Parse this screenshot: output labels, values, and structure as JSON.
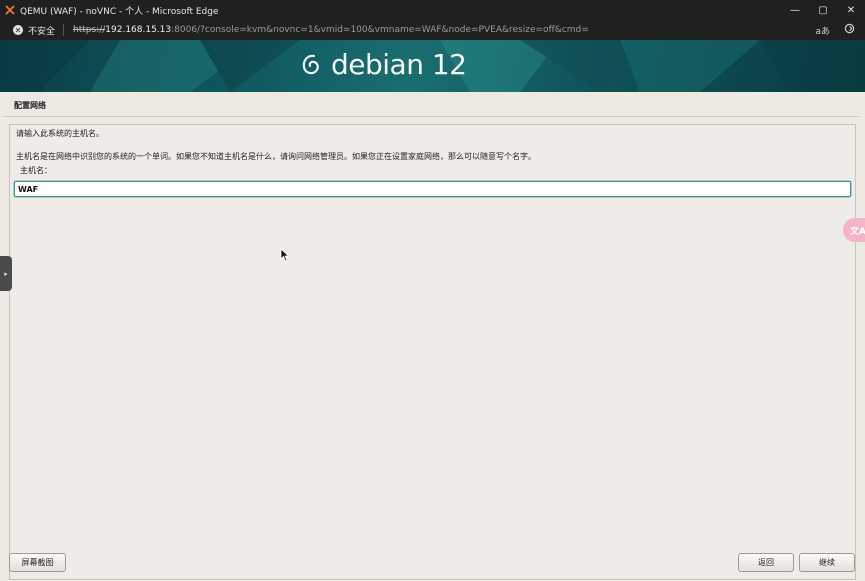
{
  "window": {
    "title": "QEMU (WAF) - noVNC - 个人 - Microsoft Edge",
    "app_icon": "novnc-x-icon",
    "controls": {
      "minimize": "—",
      "maximize": "▢",
      "close": "✕"
    }
  },
  "address_bar": {
    "security_label": "不安全",
    "security_icon": "warning-x-icon",
    "url_scheme": "https://",
    "url_host": "192.168.15.13",
    "url_rest": ":8006/?console=kvm&novnc=1&vmid=100&vmname=WAF&node=PVEA&resize=off&cmd=",
    "read_aloud_glyph": "aあ",
    "refresh_icon": "edge-refresh-icon"
  },
  "installer": {
    "brand": "debian 12",
    "section_title": "配置网络",
    "prompt": "请输入此系统的主机名。",
    "description": "主机名是在网络中识别您的系统的一个单词。如果您不知道主机名是什么，请询问网络管理员。如果您正在设置家庭网络，那么可以随意写个名字。",
    "field_label": "主机名：",
    "hostname_value": "WAF",
    "buttons": {
      "screenshot": "屏幕截图",
      "back": "返回",
      "continue": "继续"
    }
  },
  "overlay": {
    "side_tab_glyph": "▸",
    "translate_glyph": "文A"
  },
  "colors": {
    "banner_dark": "#0b3f46",
    "banner_mid": "#1a6e70",
    "installer_bg": "#ede9e3",
    "input_focus": "#4a8f86",
    "translate_pink": "#f2b4c6"
  }
}
